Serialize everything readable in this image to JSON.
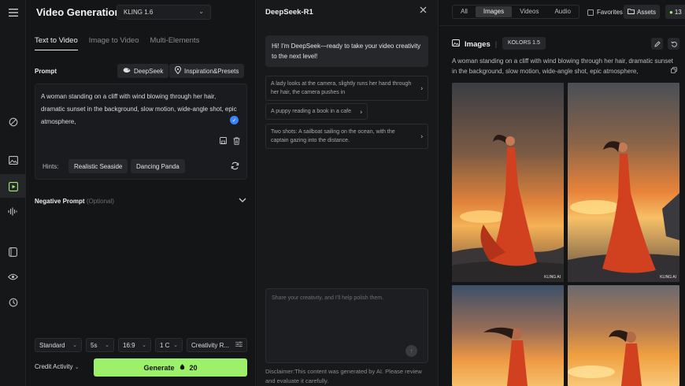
{
  "app": {
    "title": "Video Generation",
    "model": "KLING 1.6"
  },
  "tabs": [
    {
      "label": "Text to Video",
      "active": true
    },
    {
      "label": "Image to Video",
      "active": false
    },
    {
      "label": "Multi-Elements",
      "active": false
    }
  ],
  "prompt": {
    "label": "Prompt",
    "deepseek_label": "DeepSeek",
    "inspiration_label": "Inspiration&Presets",
    "text": "A woman standing on a cliff with wind blowing through her hair, dramatic sunset in the background, slow motion, wide-angle shot, epic atmosphere,",
    "hints_label": "Hints:",
    "hints": [
      "Realistic Seaside",
      "Dancing Panda"
    ]
  },
  "negative_prompt": {
    "label": "Negative Prompt",
    "optional": "(Optional)"
  },
  "settings": {
    "mode": "Standard",
    "duration": "5s",
    "ratio": "16:9",
    "count": "1 C",
    "creativity": "Creativity R..."
  },
  "footer": {
    "credit_label": "Credit Activity",
    "generate_label": "Generate",
    "generate_cost": "20"
  },
  "chat": {
    "title": "DeepSeek-R1",
    "greeting": "Hi! I'm DeepSeek—ready to take your video creativity to the next level!",
    "suggestions": [
      "A lady looks at the camera, slightly runs her hand through her hair, the camera pushes in",
      "A puppy reading a book in a cafe",
      "Two shots: A sailboat sailing on the ocean, with the captain gazing into the distance."
    ],
    "input_placeholder": "Share your creativity, and I'll help polish them.",
    "disclaimer": "Disclaimer:This content was generated by AI. Please review and evaluate it carefully."
  },
  "gallery": {
    "filters": [
      {
        "label": "All",
        "active": false
      },
      {
        "label": "Images",
        "active": true
      },
      {
        "label": "Videos",
        "active": false
      },
      {
        "label": "Audio",
        "active": false
      }
    ],
    "favorites_label": "Favorites",
    "assets_label": "Assets",
    "credits_value": "13",
    "section_title": "Images",
    "model_badge": "KOLORS 1.5",
    "description": "A woman standing on a cliff with wind blowing through her hair, dramatic sunset in the background, slow motion, wide-angle shot, epic atmosphere,",
    "watermark": "KLING AI"
  },
  "colors": {
    "accent_green": "#9df06a",
    "check_blue": "#3b82f6",
    "dress_red": "#d2411f"
  },
  "icons": {
    "menu": "menu-icon",
    "chevron": "chevron-down-icon",
    "close": "close-icon",
    "image": "image-icon",
    "edit": "edit-icon",
    "refresh": "refresh-icon"
  }
}
